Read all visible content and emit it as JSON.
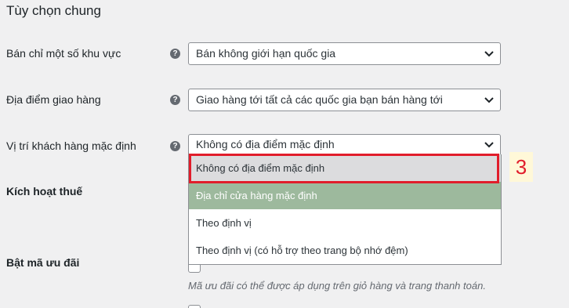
{
  "section": {
    "title": "Tùy chọn chung"
  },
  "rows": [
    {
      "label": "Bán chỉ một số khu vực",
      "value": "Bán không giới hạn quốc gia"
    },
    {
      "label": "Địa điểm giao hàng",
      "value": "Giao hàng tới tất cả các quốc gia bạn bán hàng tới"
    },
    {
      "label": "Vị trí khách hàng mặc định",
      "value": "Không có địa điểm mặc định"
    },
    {
      "label": "Kích hoạt thuế"
    },
    {
      "label": "Bật mã ưu đãi",
      "description": "Mã ưu đãi có thể được áp dụng trên giỏ hàng và trang thanh toán."
    }
  ],
  "help_icon": {
    "glyph": "?",
    "icon": "question-circle-icon"
  },
  "dropdown": {
    "options": [
      "Không có địa điểm mặc định",
      "Địa chỉ cửa hàng mặc định",
      "Theo định vị",
      "Theo định vị (có hỗ trợ theo trang bộ nhớ đệm)"
    ],
    "hovered_index": 0,
    "selected_index": 1
  },
  "annotation": {
    "number": "3",
    "color": "#e11d2b"
  },
  "colors": {
    "selected_option_bg": "#9db99d",
    "hover_bg": "#dcdcde",
    "page_bg": "#f0f0f1"
  }
}
